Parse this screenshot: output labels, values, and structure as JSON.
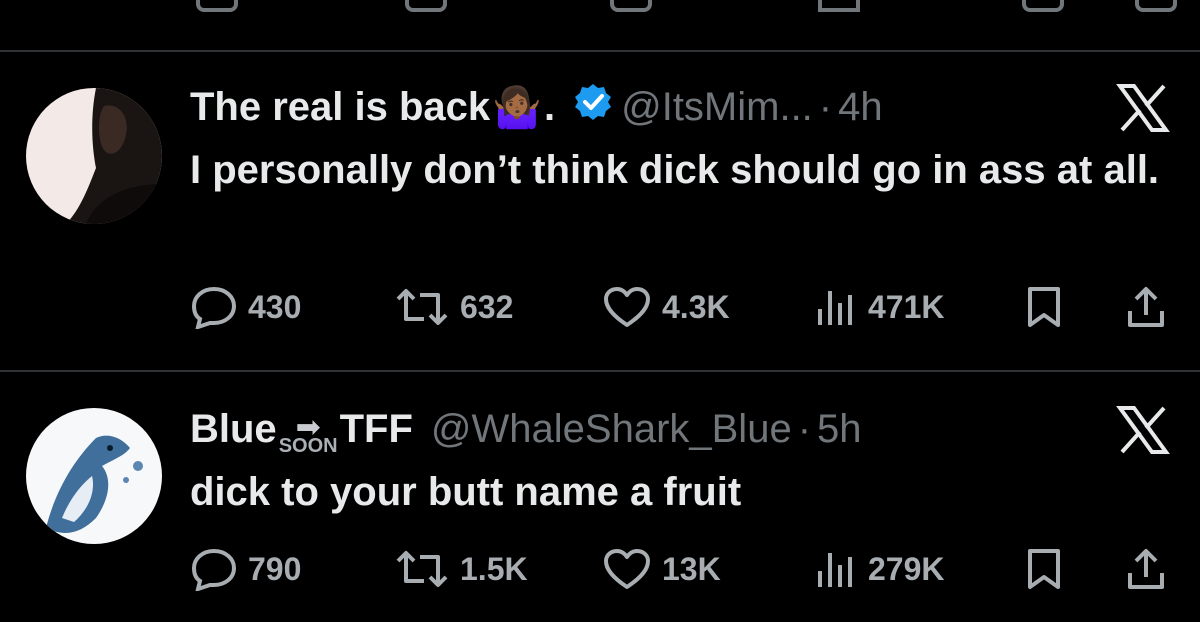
{
  "tweets": [
    {
      "display_name": "The real is back",
      "emoji": "🤷🏾‍♀️",
      "suffix": ".",
      "handle": "@ItsMim...",
      "dot": "·",
      "time": "4h",
      "text": "I personally don’t think dick should go in ass at all.",
      "replies": "430",
      "retweets": "632",
      "likes": "4.3K",
      "views": "471K"
    },
    {
      "display_name": "Blue",
      "badge_arrow": "➡",
      "badge_text": "SOON",
      "display_name_2": "TFF",
      "handle": "@WhaleShark_Blue",
      "dot": "·",
      "time": "5h",
      "text": "dick to your butt name a fruit",
      "replies": "790",
      "retweets": "1.5K",
      "likes": "13K",
      "views": "279K"
    }
  ],
  "colors": {
    "background": "#000000",
    "text": "#e7e9ea",
    "muted": "#71767b",
    "verified": "#1d9bf0",
    "divider": "#2f3336"
  },
  "icons": [
    "reply-icon",
    "retweet-icon",
    "like-icon",
    "views-icon",
    "bookmark-icon",
    "share-icon",
    "x-logo-icon",
    "verified-badge-icon"
  ]
}
